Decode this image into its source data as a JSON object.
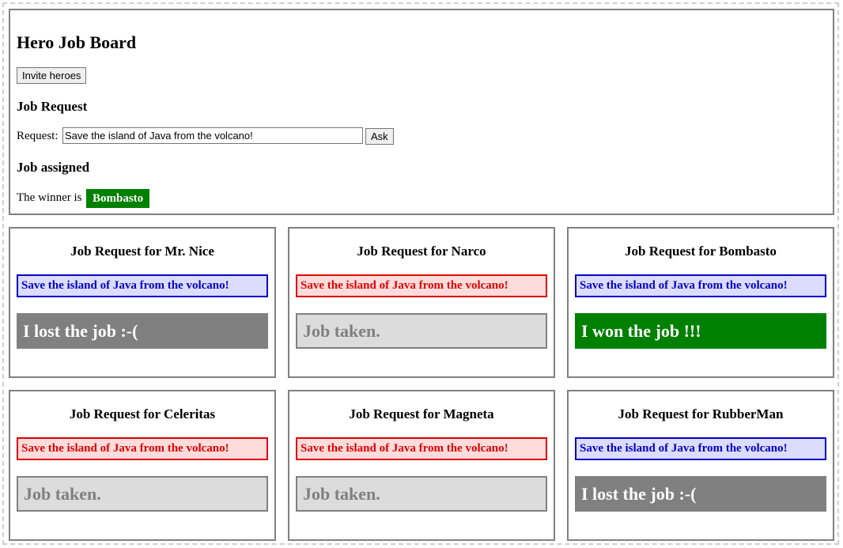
{
  "board": {
    "title": "Hero Job Board",
    "invite_label": "Invite heroes",
    "job_request_heading": "Job Request",
    "request_label": "Request:",
    "request_value": "Save the island of Java from the volcano!",
    "ask_label": "Ask",
    "job_assigned_heading": "Job assigned",
    "winner_prefix": "The winner is",
    "winner_name": "Bombasto",
    "winner_color": "#008000"
  },
  "cards": [
    {
      "title": "Job Request for Mr. Nice",
      "request": "Save the island of Java from the volcano!",
      "request_style": "blue",
      "status": "I lost the job :-(",
      "status_style": "lost"
    },
    {
      "title": "Job Request for Narco",
      "request": "Save the island of Java from the volcano!",
      "request_style": "red",
      "status": "Job taken.",
      "status_style": "taken"
    },
    {
      "title": "Job Request for Bombasto",
      "request": "Save the island of Java from the volcano!",
      "request_style": "blue",
      "status": "I won the job !!!",
      "status_style": "won"
    },
    {
      "title": "Job Request for Celeritas",
      "request": "Save the island of Java from the volcano!",
      "request_style": "red",
      "status": "Job taken.",
      "status_style": "taken"
    },
    {
      "title": "Job Request for Magneta",
      "request": "Save the island of Java from the volcano!",
      "request_style": "red",
      "status": "Job taken.",
      "status_style": "taken"
    },
    {
      "title": "Job Request for RubberMan",
      "request": "Save the island of Java from the volcano!",
      "request_style": "blue",
      "status": "I lost the job :-(",
      "status_style": "lost"
    }
  ]
}
